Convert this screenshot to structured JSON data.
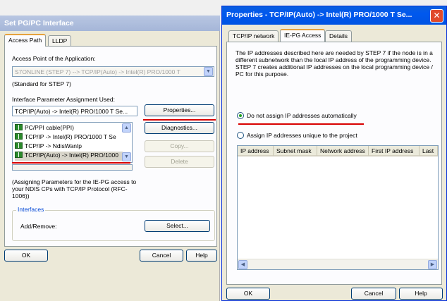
{
  "left_dialog": {
    "title": "Set PG/PC Interface",
    "tabs": [
      "Access Path",
      "LLDP"
    ],
    "access_point_label": "Access Point of the Application:",
    "access_point_value": "S7ONLINE     (STEP 7)       --> TCP/IP(Auto) -> Intel(R) PRO/1000 T",
    "access_point_note": "(Standard for STEP 7)",
    "assignment_label": "Interface Parameter Assignment Used:",
    "assignment_value": "TCP/IP(Auto) -> Intel(R) PRO/1000 T Se...",
    "list_items": [
      "PC/PPI cable(PPI)",
      "TCP/IP -> Intel(R) PRO/1000 T Se",
      "TCP/IP -> NdisWanIp",
      "TCP/IP(Auto) -> Intel(R) PRO/1000"
    ],
    "buttons": {
      "properties": "Properties...",
      "diagnostics": "Diagnostics...",
      "copy": "Copy...",
      "delete": "Delete",
      "select": "Select...",
      "ok": "OK",
      "cancel": "Cancel",
      "help": "Help"
    },
    "description": "(Assigning Parameters for the IE-PG access to your NDIS CPs with TCP/IP Protocol (RFC-1006))",
    "interfaces_group": "Interfaces",
    "add_remove_label": "Add/Remove:"
  },
  "right_dialog": {
    "title": "Properties - TCP/IP(Auto) -> Intel(R) PRO/1000 T Se...",
    "tabs": [
      "TCP/IP network",
      "IE-PG Access",
      "Details"
    ],
    "info_text": "The IP addresses described here are needed by STEP 7 if the node is in a different subnetwork than the local IP address of the programming device. STEP 7 creates additional IP addresses on the local programming device / PC for this purpose.",
    "radio_options": [
      {
        "label": "Do not assign IP addresses automatically",
        "checked": true
      },
      {
        "label": "Assign IP addresses unique to the project",
        "checked": false
      }
    ],
    "table_columns": [
      "IP address",
      "Subnet mask",
      "Network address",
      "First IP address",
      "Last"
    ],
    "buttons": {
      "ok": "OK",
      "cancel": "Cancel",
      "help": "Help"
    }
  },
  "colors": {
    "annotation_red": "#d80000",
    "title_blue": "#0054e3"
  }
}
